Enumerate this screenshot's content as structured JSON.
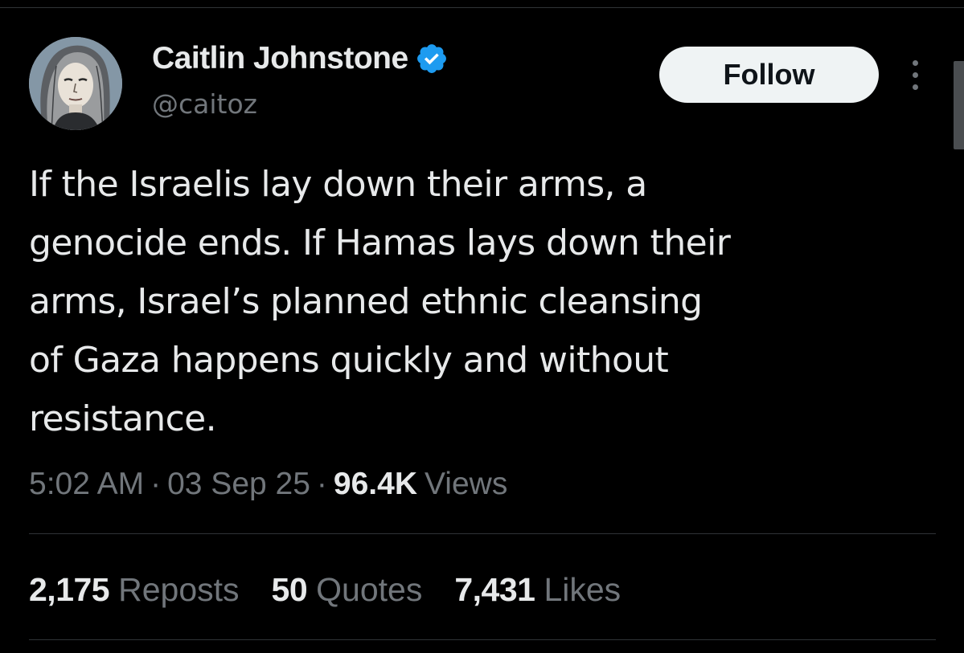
{
  "author": {
    "display_name": "Caitlin Johnstone",
    "handle": "@caitoz",
    "verified_badge_icon": "verified-badge-icon",
    "verified_color": "#1d9bf0"
  },
  "follow_button": {
    "label": "Follow"
  },
  "more_button": {
    "icon": "more-vertical-icon"
  },
  "tweet": {
    "text": "If the Israelis lay down their arms, a\ngenocide ends. If Hamas lays down their\narms, Israel’s planned ethnic cleansing\nof Gaza happens quickly and without\nresistance."
  },
  "meta": {
    "time": "5:02 AM",
    "separator": "·",
    "date": "03 Sep 25",
    "views_count": "96.4K",
    "views_label": "Views"
  },
  "stats": [
    {
      "count": "2,175",
      "label": "Reposts"
    },
    {
      "count": "50",
      "label": "Quotes"
    },
    {
      "count": "7,431",
      "label": "Likes"
    }
  ],
  "colors": {
    "background": "#000000",
    "primary_text": "#e7e9ea",
    "secondary_text": "#71767b",
    "divider": "#2f3336",
    "follow_button_bg": "#eff3f4",
    "follow_button_text": "#0f1419"
  }
}
